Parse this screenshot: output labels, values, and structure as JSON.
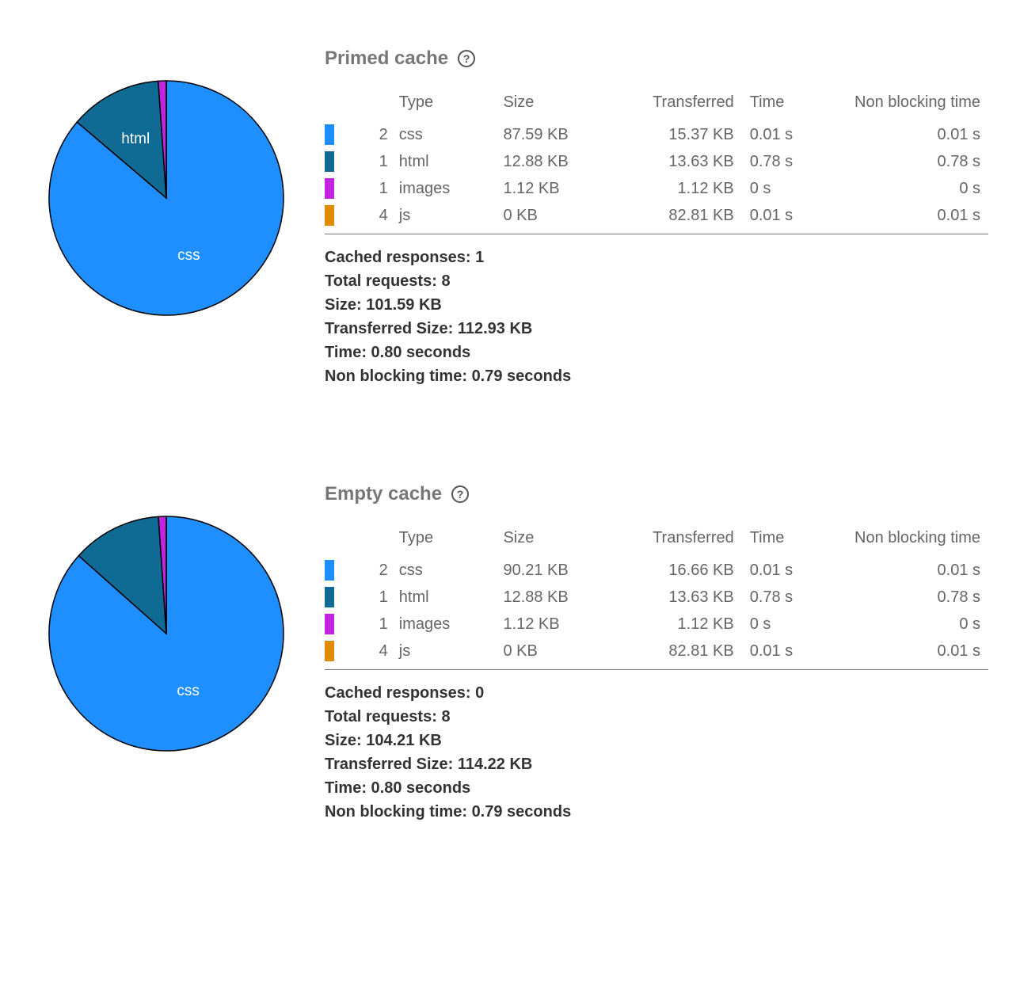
{
  "colors": {
    "css": "#1f8fff",
    "html": "#106b94",
    "images": "#c223e0",
    "js": "#e38b00"
  },
  "headers": {
    "type": "Type",
    "size": "Size",
    "transferred": "Transferred",
    "time": "Time",
    "nbt": "Non blocking time"
  },
  "summary_labels": {
    "cached": "Cached responses:",
    "requests": "Total requests:",
    "size": "Size:",
    "tsize": "Transferred Size:",
    "time": "Time:",
    "nbt": "Non blocking time:"
  },
  "help_glyph": "?",
  "sections": [
    {
      "title": "Primed cache",
      "pie_labels": {
        "css": "css",
        "html": "html"
      },
      "rows": [
        {
          "color_key": "css",
          "count": "2",
          "type": "css",
          "size": "87.59 KB",
          "transferred": "15.37 KB",
          "time": "0.01 s",
          "nbt": "0.01 s"
        },
        {
          "color_key": "html",
          "count": "1",
          "type": "html",
          "size": "12.88 KB",
          "transferred": "13.63 KB",
          "time": "0.78 s",
          "nbt": "0.78 s"
        },
        {
          "color_key": "images",
          "count": "1",
          "type": "images",
          "size": "1.12 KB",
          "transferred": "1.12 KB",
          "time": "0 s",
          "nbt": "0 s"
        },
        {
          "color_key": "js",
          "count": "4",
          "type": "js",
          "size": "0 KB",
          "transferred": "82.81 KB",
          "time": "0.01 s",
          "nbt": "0.01 s"
        }
      ],
      "summary": {
        "cached": "1",
        "requests": "8",
        "size": "101.59 KB",
        "tsize": "112.93 KB",
        "time": "0.80 seconds",
        "nbt": "0.79 seconds"
      }
    },
    {
      "title": "Empty cache",
      "pie_labels": {
        "css": "css"
      },
      "rows": [
        {
          "color_key": "css",
          "count": "2",
          "type": "css",
          "size": "90.21 KB",
          "transferred": "16.66 KB",
          "time": "0.01 s",
          "nbt": "0.01 s"
        },
        {
          "color_key": "html",
          "count": "1",
          "type": "html",
          "size": "12.88 KB",
          "transferred": "13.63 KB",
          "time": "0.78 s",
          "nbt": "0.78 s"
        },
        {
          "color_key": "images",
          "count": "1",
          "type": "images",
          "size": "1.12 KB",
          "transferred": "1.12 KB",
          "time": "0 s",
          "nbt": "0 s"
        },
        {
          "color_key": "js",
          "count": "4",
          "type": "js",
          "size": "0 KB",
          "transferred": "82.81 KB",
          "time": "0.01 s",
          "nbt": "0.01 s"
        }
      ],
      "summary": {
        "cached": "0",
        "requests": "8",
        "size": "104.21 KB",
        "tsize": "114.22 KB",
        "time": "0.80 seconds",
        "nbt": "0.79 seconds"
      }
    }
  ],
  "chart_data": [
    {
      "type": "pie",
      "title": "Primed cache",
      "series": [
        {
          "name": "css",
          "value": 87.59,
          "color": "#1f8fff"
        },
        {
          "name": "html",
          "value": 12.88,
          "color": "#106b94"
        },
        {
          "name": "images",
          "value": 1.12,
          "color": "#c223e0"
        },
        {
          "name": "js",
          "value": 0,
          "color": "#e38b00"
        }
      ]
    },
    {
      "type": "pie",
      "title": "Empty cache",
      "series": [
        {
          "name": "css",
          "value": 90.21,
          "color": "#1f8fff"
        },
        {
          "name": "html",
          "value": 12.88,
          "color": "#106b94"
        },
        {
          "name": "images",
          "value": 1.12,
          "color": "#c223e0"
        },
        {
          "name": "js",
          "value": 0,
          "color": "#e38b00"
        }
      ]
    }
  ]
}
